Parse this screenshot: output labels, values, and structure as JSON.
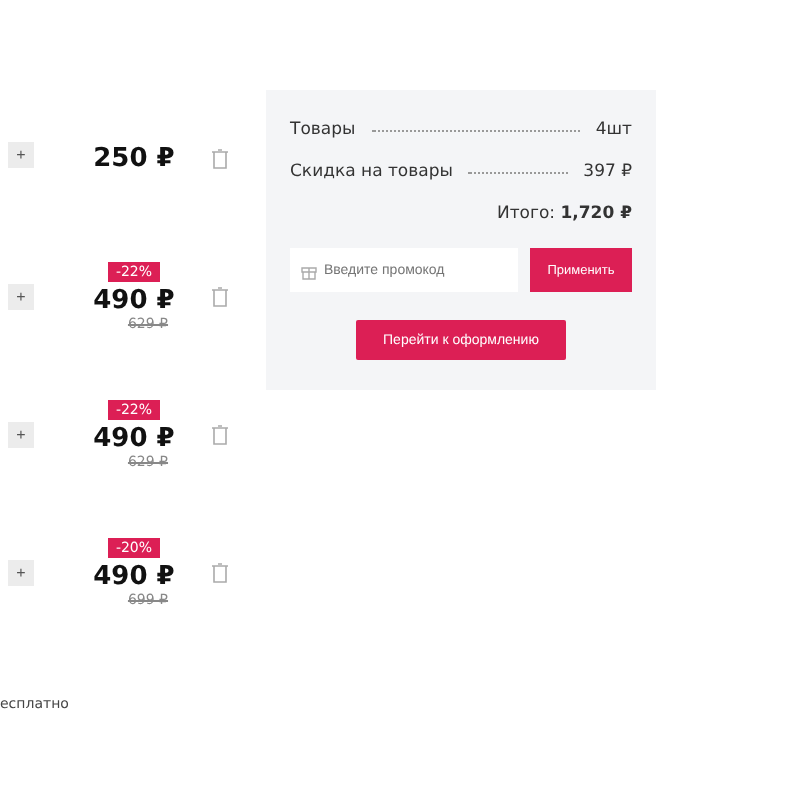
{
  "cart_items": [
    {
      "quantity_button": "+",
      "price": "250 ₽"
    },
    {
      "quantity_button": "+",
      "discount": "-22%",
      "price": "490 ₽",
      "old_price": "629 ₽"
    },
    {
      "quantity_button": "+",
      "discount": "-22%",
      "price": "490 ₽",
      "old_price": "629 ₽"
    },
    {
      "quantity_button": "+",
      "discount": "-20%",
      "price": "490 ₽",
      "old_price": "699 ₽"
    }
  ],
  "footer_text": "есплатно",
  "summary": {
    "rows": [
      {
        "label": "Товары",
        "value": "4шт"
      },
      {
        "label": "Скидка на товары",
        "value": "397 ₽"
      }
    ],
    "total_label": "Итого:",
    "total_value": "1,720 ₽",
    "promo": {
      "placeholder": "Введите промокод",
      "button": "Применить"
    },
    "checkout_button": "Перейти к оформлению"
  }
}
